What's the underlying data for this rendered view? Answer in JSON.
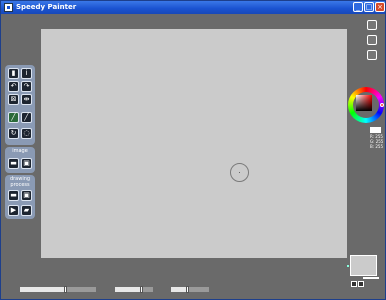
{
  "window": {
    "title": "Speedy Painter"
  },
  "titlebar_buttons": [
    "_",
    "□",
    "×"
  ],
  "toolbox": {
    "image_group_label": "image",
    "process_group_label": "drawing\nprocess"
  },
  "tools": [
    "new-document-icon",
    "info-icon",
    "undo-icon",
    "redo-icon",
    "resize-icon",
    "flip-icon",
    "brush-icon",
    "eraser-icon",
    "reset-view-icon",
    "history-icon",
    "open-image-icon",
    "save-image-icon",
    "open-process-icon",
    "save-process-icon",
    "play-icon",
    "export-icon"
  ],
  "color": {
    "r": "R: 255",
    "g": "G: 255",
    "b": "B: 255",
    "swatch": "#ffffff",
    "wheel_hue": "#ff0000"
  },
  "sliders": [
    {
      "name": "brush-size",
      "value": 0.6
    },
    {
      "name": "brush-opacity",
      "value": 0.7
    },
    {
      "name": "brush-softness",
      "value": 0.45
    }
  ]
}
